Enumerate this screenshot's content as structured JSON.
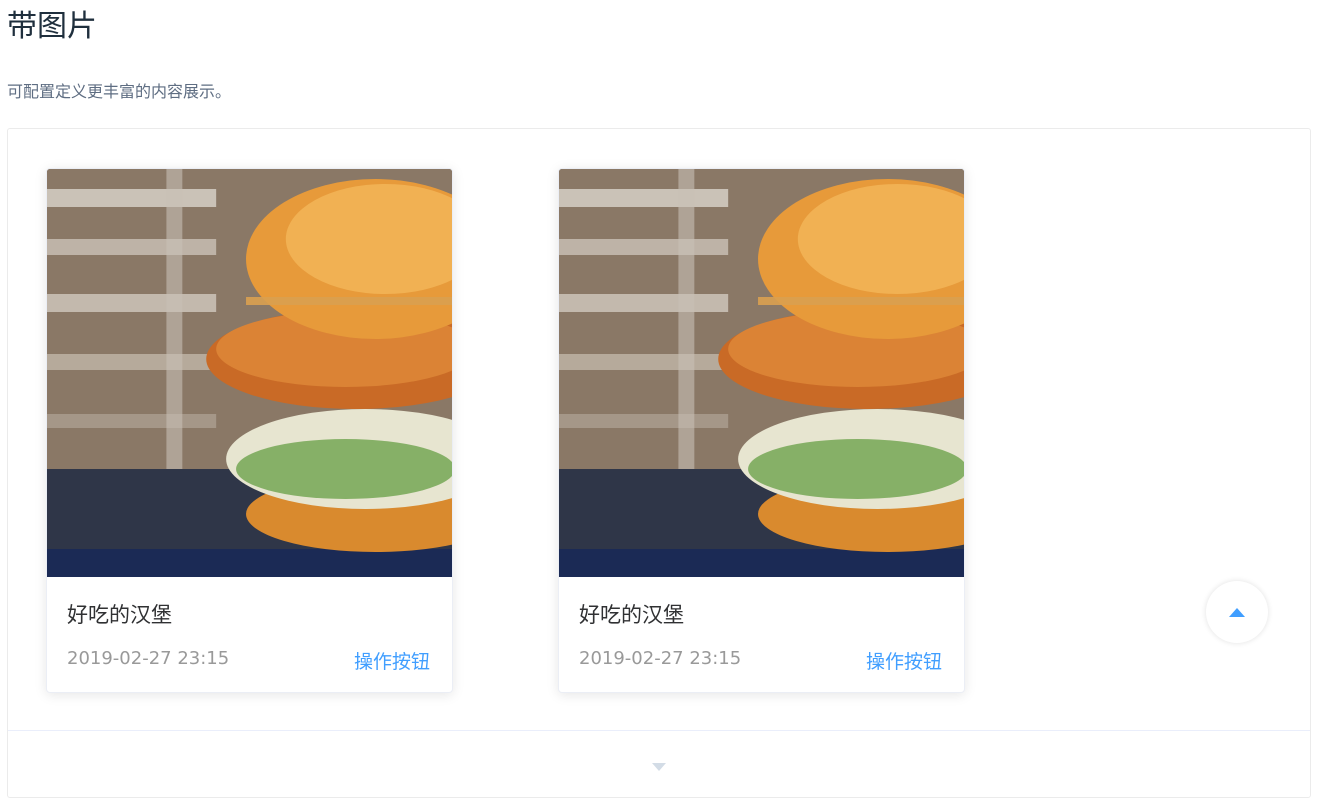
{
  "header": {
    "title": "带图片",
    "description": "可配置定义更丰富的内容展示。"
  },
  "cards": [
    {
      "image_alt": "burger",
      "title": "好吃的汉堡",
      "time": "2019-02-27 23:15",
      "button_label": "操作按钮"
    },
    {
      "image_alt": "burger",
      "title": "好吃的汉堡",
      "time": "2019-02-27 23:15",
      "button_label": "操作按钮"
    }
  ],
  "backtop": {
    "icon": "caret-up-icon"
  },
  "demo_control": {
    "icon": "caret-down-icon"
  },
  "colors": {
    "accent": "#409eff",
    "title": "#1f2f3d",
    "description": "#5e6d82",
    "time": "#999999"
  }
}
